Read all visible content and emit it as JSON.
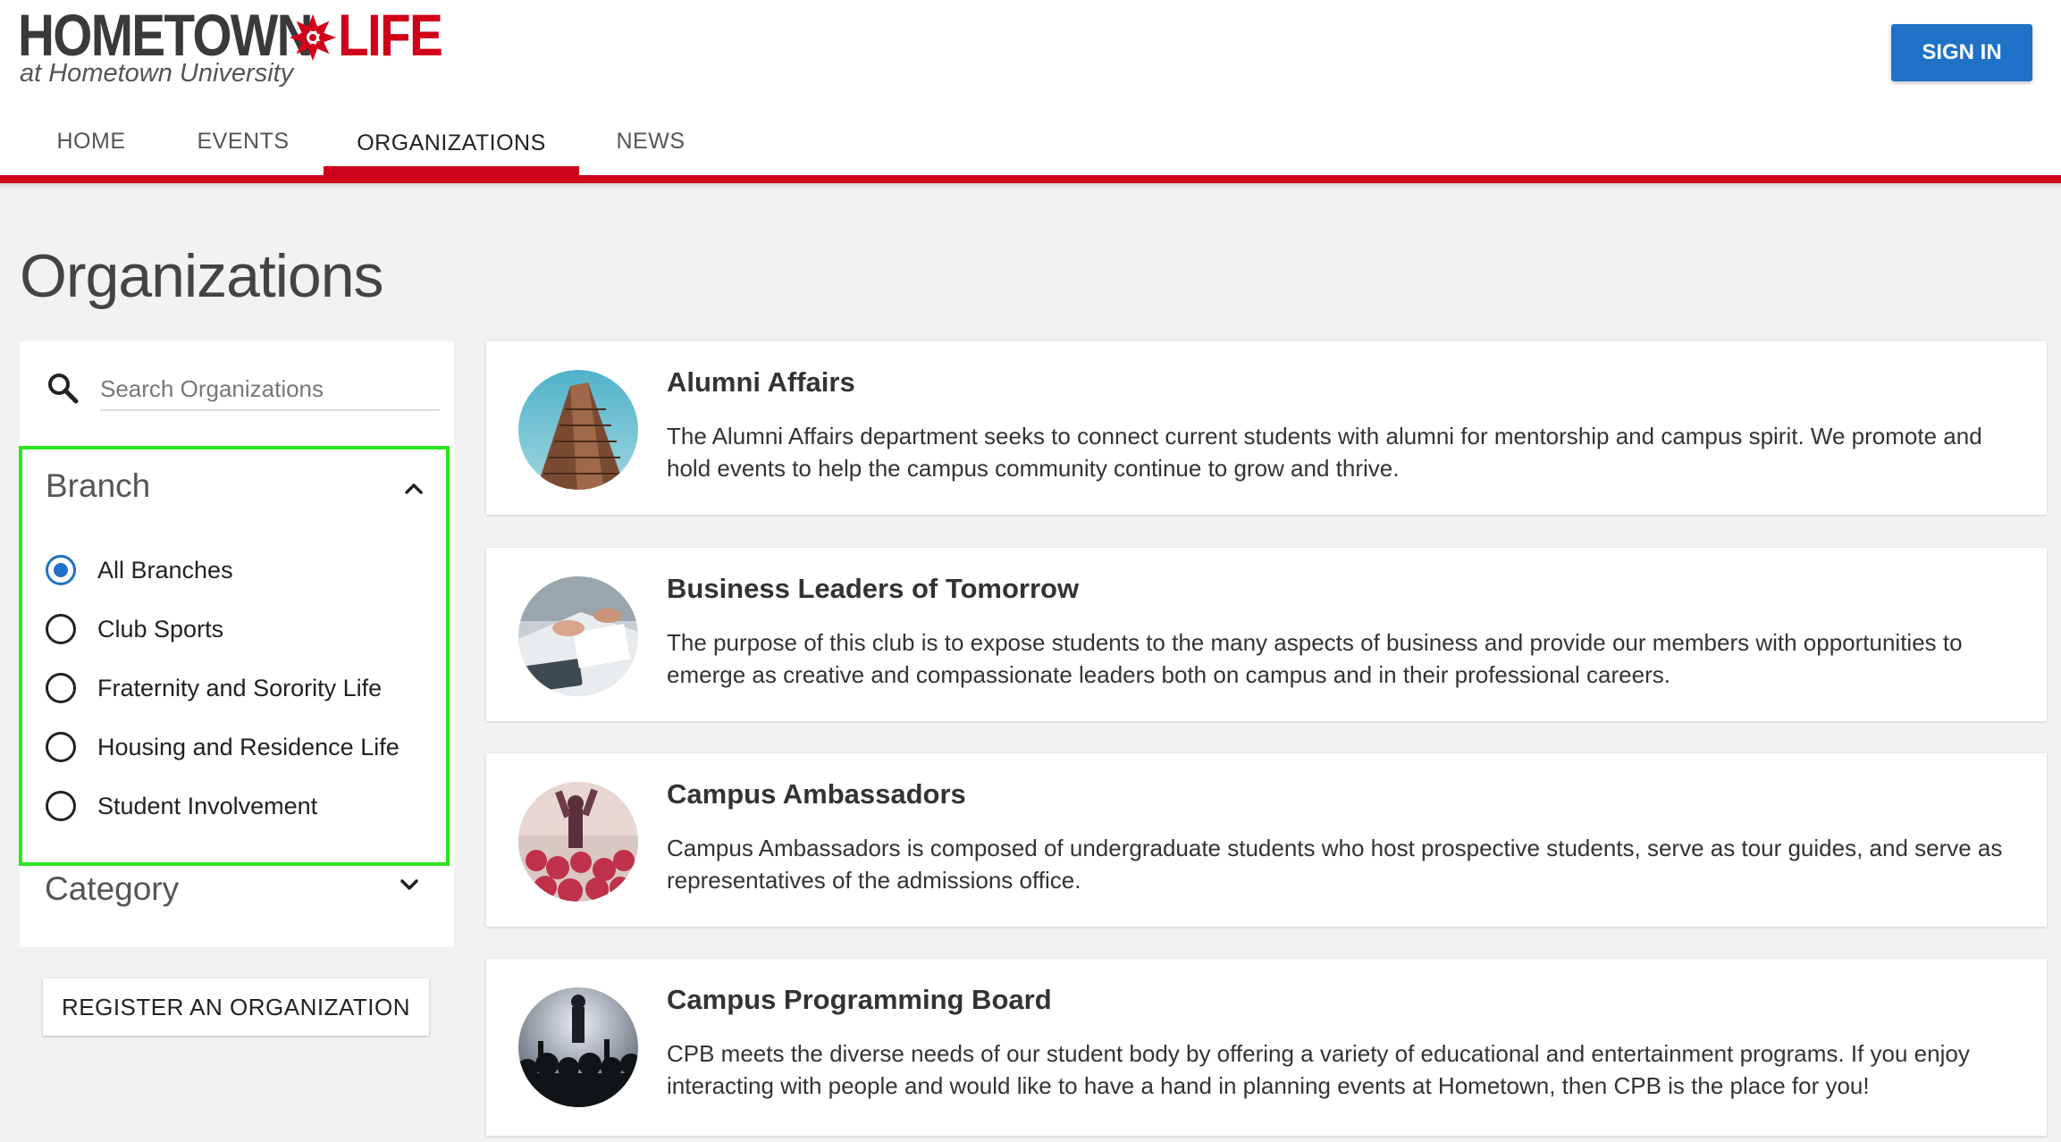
{
  "header": {
    "logo_home": "HOMETOWN",
    "logo_life": "LIFE",
    "logo_subtitle": "at Hometown University",
    "signin_label": "SIGN IN"
  },
  "nav": {
    "tabs": [
      {
        "label": "HOME"
      },
      {
        "label": "EVENTS"
      },
      {
        "label": "ORGANIZATIONS"
      },
      {
        "label": "NEWS"
      }
    ],
    "active_tab": "ORGANIZATIONS"
  },
  "page": {
    "title": "Organizations"
  },
  "sidebar": {
    "search_placeholder": "Search Organizations",
    "search_value": "",
    "branch": {
      "title": "Branch",
      "expanded": true,
      "options": [
        {
          "label": "All Branches",
          "checked": true
        },
        {
          "label": "Club Sports",
          "checked": false
        },
        {
          "label": "Fraternity and Sorority Life",
          "checked": false
        },
        {
          "label": "Housing and Residence Life",
          "checked": false
        },
        {
          "label": "Student Involvement",
          "checked": false
        }
      ]
    },
    "category": {
      "title": "Category",
      "expanded": false
    },
    "register_label": "REGISTER AN ORGANIZATION"
  },
  "organizations": [
    {
      "name": "Alumni Affairs",
      "description": "The Alumni Affairs department seeks to connect current students with alumni for mentorship and campus spirit. We promote and hold events to help the campus community continue to grow and thrive.",
      "image": "skyscraper-photo"
    },
    {
      "name": "Business Leaders of Tomorrow",
      "description": "The purpose of this club is to expose students to the many aspects of business and provide our members with opportunities to emerge as creative and compassionate leaders both on campus and in their professional careers.",
      "image": "desk-laptop-photo"
    },
    {
      "name": "Campus Ambassadors",
      "description": "Campus Ambassadors is composed of undergraduate students who host prospective students, serve as tour guides, and serve as representatives of the admissions office.",
      "image": "cheering-crowd-photo"
    },
    {
      "name": "Campus Programming Board",
      "description": "CPB meets the diverse needs of our student body by offering a variety of educational and entertainment programs. If you enjoy interacting with people and would like to have a hand in planning events at Hometown, then CPB is the place for you!",
      "image": "concert-crowd-photo"
    }
  ],
  "colors": {
    "brand_red": "#d0021b",
    "primary_blue": "#1f72c7",
    "highlight_green": "#29e61f",
    "page_background": "#f2f2f2"
  }
}
